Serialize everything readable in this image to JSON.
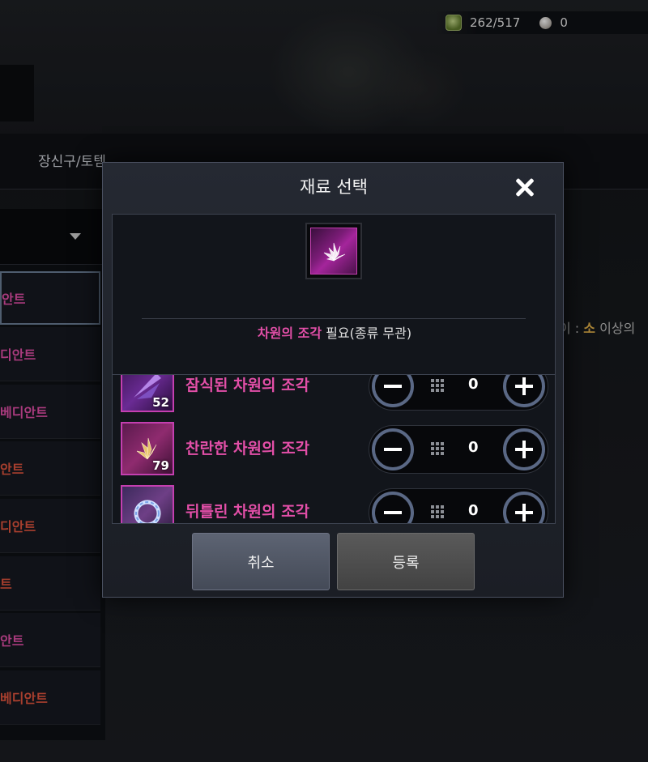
{
  "currency": {
    "stamina": "262/517",
    "pearls": "0"
  },
  "background": {
    "header_tab": "장신구/토템",
    "side_list": [
      {
        "label": "안트",
        "color": "#e34fa8"
      },
      {
        "label": "디안트",
        "color": "#e34fa8"
      },
      {
        "label": "베디안트",
        "color": "#e34fa8"
      },
      {
        "label": "안트",
        "color": "#e0543e"
      },
      {
        "label": "디안트",
        "color": "#e0543e"
      },
      {
        "label": "트",
        "color": "#e0543e"
      },
      {
        "label": "안트",
        "color": "#e34fa8"
      },
      {
        "label": "베디안트",
        "color": "#e0543e"
      }
    ],
    "right_note_prefix": "이 : ",
    "right_note_gold": "소",
    "right_note_suffix": " 이상의"
  },
  "modal": {
    "title": "재료 선택",
    "requirement": {
      "item_name": "차원의 조각",
      "rest": " 필요(종류 무관)"
    },
    "items": [
      {
        "name": "잠식된 차원의 조각",
        "count": "52",
        "quantity": "0",
        "icon": "corrupted-shard-icon"
      },
      {
        "name": "찬란한 차원의 조각",
        "count": "79",
        "quantity": "0",
        "icon": "radiant-shard-icon"
      },
      {
        "name": "뒤틀린 차원의 조각",
        "count": "",
        "quantity": "0",
        "icon": "twisted-shard-icon"
      }
    ],
    "cancel_label": "취소",
    "confirm_label": "등록"
  }
}
